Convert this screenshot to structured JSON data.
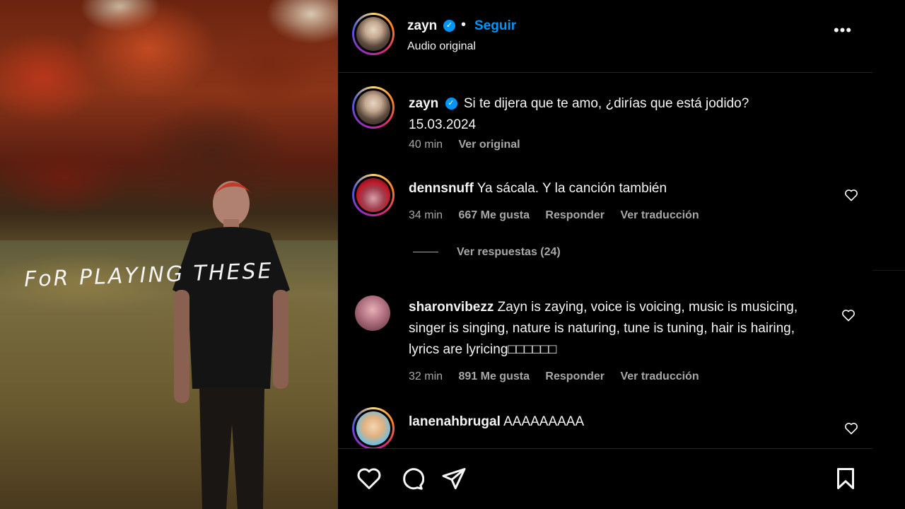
{
  "media": {
    "overlay_text": "FoR PLAYING THESE"
  },
  "header": {
    "username": "zayn",
    "separator": "•",
    "follow_label": "Seguir",
    "audio_label": "Audio original",
    "more_icon": "more-options-icon",
    "more_glyph": "•••"
  },
  "caption": {
    "username": "zayn",
    "text": "Si te dijera que te amo, ¿dirías que está jodido?",
    "date": "15.03.2024",
    "time": "40 min",
    "see_original": "Ver original"
  },
  "comments": [
    {
      "username": "dennsnuff",
      "text": "Ya sácala. Y la canción también",
      "time": "34 min",
      "likes": "667 Me gusta",
      "reply": "Responder",
      "translate": "Ver traducción",
      "view_replies": "Ver respuestas (24)"
    },
    {
      "username": "sharonvibezz",
      "text": "Zayn is zaying, voice is voicing, music is musicing, singer is singing, nature is naturing, tune is tuning, hair is hairing, lyrics are lyricing□□□□□□",
      "time": "32 min",
      "likes": "891 Me gusta",
      "reply": "Responder",
      "translate": "Ver traducción"
    },
    {
      "username": "lanenahbrugal",
      "text": "AAAAAAAAA"
    }
  ],
  "actions": [
    "like-icon",
    "comment-icon",
    "share-icon",
    "save-icon"
  ],
  "colors": {
    "background": "#000000",
    "accent_blue": "#0095f6",
    "text_primary": "#f5f5f5",
    "text_secondary": "#a8a8a8"
  }
}
